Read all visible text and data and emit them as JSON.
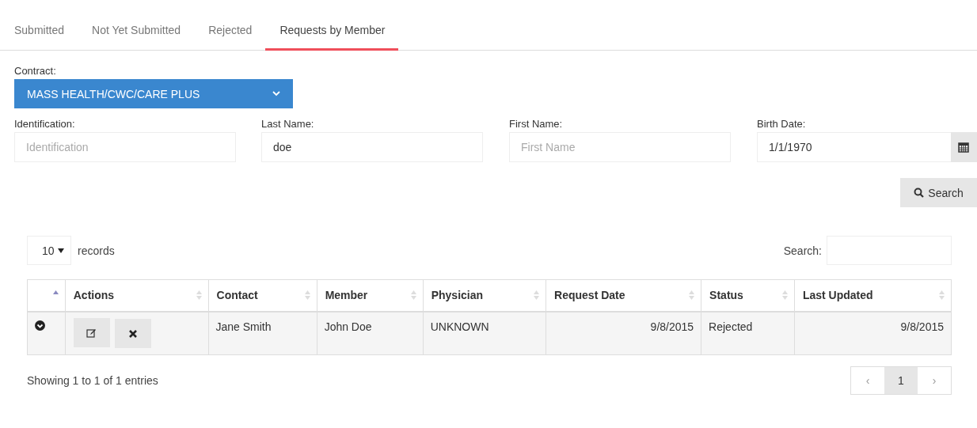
{
  "tabs": [
    {
      "label": "Submitted",
      "selected": false
    },
    {
      "label": "Not Yet Submitted",
      "selected": false
    },
    {
      "label": "Rejected",
      "selected": false
    },
    {
      "label": "Requests by Member",
      "selected": true
    }
  ],
  "contract": {
    "label": "Contract:",
    "value": "MASS HEALTH/CWC/CARE PLUS"
  },
  "fields": [
    {
      "label": "Identification:",
      "placeholder": "Identification",
      "kind": "text"
    },
    {
      "label": "Last Name:",
      "value": "doe",
      "kind": "text"
    },
    {
      "label": "First Name:",
      "placeholder": "First Name",
      "kind": "text"
    },
    {
      "label": "Birth Date:",
      "value": "1/1/1970",
      "kind": "date"
    }
  ],
  "search_button": "Search",
  "table": {
    "page_size": "10",
    "records_label": "records",
    "search_label": "Search:",
    "columns": [
      {
        "sorted": true
      },
      {
        "label": "Actions",
        "sorted": false
      },
      {
        "label": "Contact",
        "sorted": false
      },
      {
        "label": "Member",
        "sorted": false
      },
      {
        "label": "Physician",
        "sorted": false
      },
      {
        "label": "Request Date",
        "sorted": false
      },
      {
        "label": "Status",
        "sorted": false
      },
      {
        "label": "Last Updated",
        "sorted": false
      }
    ],
    "rows": [
      {
        "contact": "Jane Smith",
        "member": "John Doe",
        "physician": "UNKNOWN",
        "request_date": "9/8/2015",
        "status": "Rejected",
        "last_updated": "9/8/2015"
      }
    ],
    "info": "Showing 1 to 1 of 1 entries",
    "pagination": [
      {
        "label": "‹",
        "selected": false
      },
      {
        "label": "1",
        "selected": true
      },
      {
        "label": "›",
        "selected": false
      }
    ]
  }
}
